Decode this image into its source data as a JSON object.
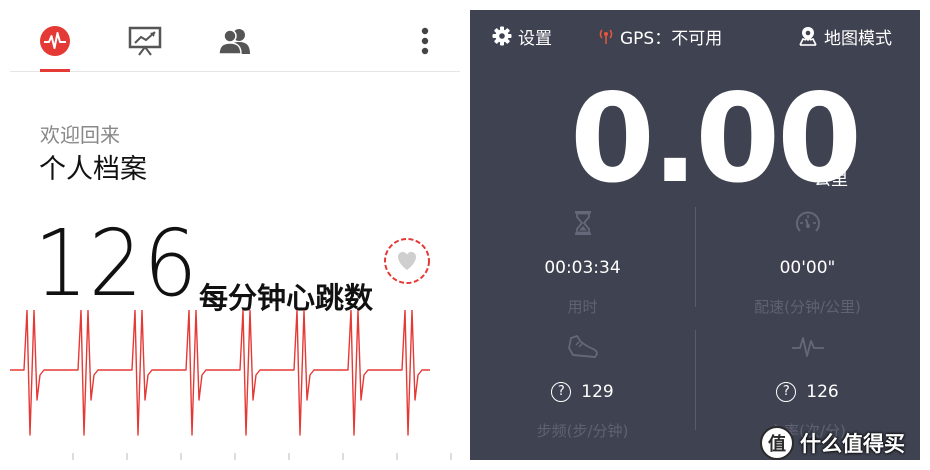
{
  "left": {
    "tabs": [
      {
        "icon": "heartbeat-icon",
        "active": true
      },
      {
        "icon": "chart-board-icon",
        "active": false
      },
      {
        "icon": "friends-icon",
        "active": false
      }
    ],
    "menu_icon": "more-vertical-icon",
    "welcome": "欢迎回来",
    "profile_title": "个人档案",
    "bpm_value": "126",
    "bpm_label": "每分钟心跳数",
    "heart_badge_icon": "heart-icon",
    "colors": {
      "accent": "#e53935",
      "ecg_line": "#e53935",
      "text": "#111111",
      "muted": "#888888"
    }
  },
  "right": {
    "settings_label": "设置",
    "gps_label": "GPS：不可用",
    "map_mode_label": "地图模式",
    "distance_value": "0.00",
    "distance_unit": "公里",
    "stats": {
      "time": {
        "icon": "hourglass-icon",
        "value": "00:03:34",
        "label": "用时"
      },
      "pace": {
        "icon": "speedometer-icon",
        "value": "00'00\"",
        "label": "配速(分钟/公里)"
      },
      "steps": {
        "icon": "shoe-icon",
        "help": "?",
        "value": "129",
        "label": "步频(步/分钟)"
      },
      "heartrate": {
        "icon": "pulse-icon",
        "help": "?",
        "value": "126",
        "label": "心率(次/分)"
      }
    },
    "colors": {
      "background": "#3f4250",
      "label": "#5f6272",
      "gps_icon": "#e8573a"
    }
  },
  "watermark": {
    "logo_char": "值",
    "text": "什么值得买"
  }
}
